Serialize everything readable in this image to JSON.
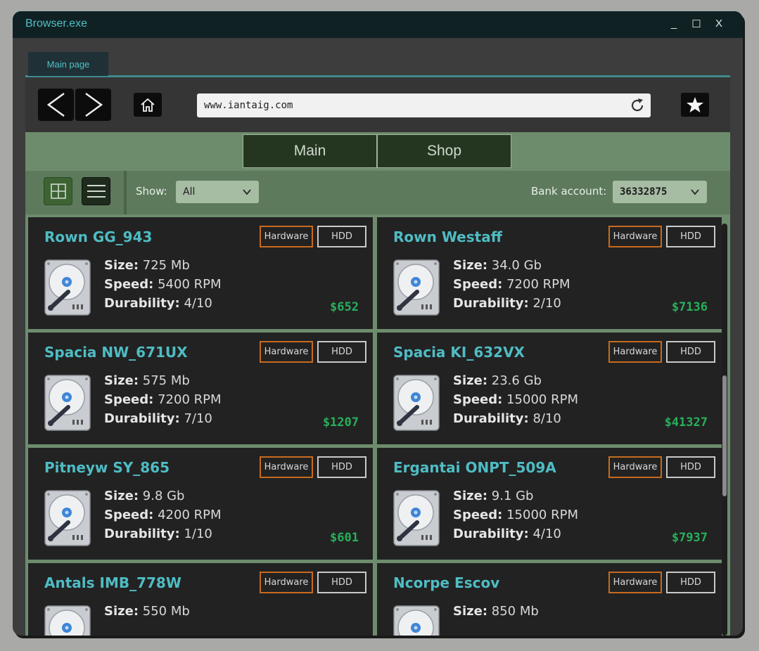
{
  "window": {
    "title": "Browser.exe",
    "minimize": "_",
    "maximize": "☐",
    "close": "X"
  },
  "tabs": [
    {
      "label": "Main page"
    }
  ],
  "address": {
    "url": "www.iantaig.com"
  },
  "site_nav": {
    "main": "Main",
    "shop": "Shop"
  },
  "toolbar": {
    "show_label": "Show:",
    "show_value": "All",
    "bank_label": "Bank account:",
    "bank_value": "36332875"
  },
  "labels": {
    "size": "Size:",
    "speed": "Speed:",
    "durability": "Durability:"
  },
  "products": [
    {
      "name": "Rown GG_943",
      "category": "Hardware",
      "type": "HDD",
      "size": "725 Mb",
      "speed": "5400 RPM",
      "durability": "4/10",
      "price": "$652"
    },
    {
      "name": "Rown Westaff",
      "category": "Hardware",
      "type": "HDD",
      "size": "34.0 Gb",
      "speed": "7200 RPM",
      "durability": "2/10",
      "price": "$7136"
    },
    {
      "name": "Spacia NW_671UX",
      "category": "Hardware",
      "type": "HDD",
      "size": "575 Mb",
      "speed": "7200 RPM",
      "durability": "7/10",
      "price": "$1207"
    },
    {
      "name": "Spacia KI_632VX",
      "category": "Hardware",
      "type": "HDD",
      "size": "23.6 Gb",
      "speed": "15000 RPM",
      "durability": "8/10",
      "price": "$41327"
    },
    {
      "name": "Pitneyw SY_865",
      "category": "Hardware",
      "type": "HDD",
      "size": "9.8 Gb",
      "speed": "4200 RPM",
      "durability": "1/10",
      "price": "$601"
    },
    {
      "name": "Ergantai ONPT_509A",
      "category": "Hardware",
      "type": "HDD",
      "size": "9.1 Gb",
      "speed": "15000 RPM",
      "durability": "4/10",
      "price": "$7937"
    },
    {
      "name": "Antals IMB_778W",
      "category": "Hardware",
      "type": "HDD",
      "size": "550 Mb"
    },
    {
      "name": "Ncorpe Escov",
      "category": "Hardware",
      "type": "HDD",
      "size": "850 Mb"
    }
  ],
  "colors": {
    "accent": "#4fbcc4",
    "price": "#27b05b",
    "hardware_tag": "#c86a1e",
    "page_green": "#6d8c6c"
  }
}
